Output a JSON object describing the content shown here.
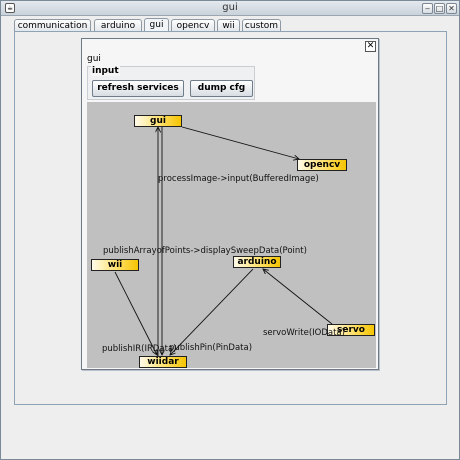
{
  "window": {
    "title": "gui",
    "app_icon": "java-cup-icon",
    "controls": [
      "minimize-icon",
      "maximize-icon",
      "close-icon"
    ]
  },
  "tabs": [
    {
      "label": "communication",
      "selected": false
    },
    {
      "label": "arduino",
      "selected": false
    },
    {
      "label": "gui",
      "selected": true
    },
    {
      "label": "opencv",
      "selected": false
    },
    {
      "label": "wii",
      "selected": false
    },
    {
      "label": "custom",
      "selected": false
    }
  ],
  "panel": {
    "title": "gui",
    "close_symbol": "✕",
    "input_group": {
      "label": "input",
      "buttons": [
        "refresh services",
        "dump cfg"
      ]
    }
  },
  "graph": {
    "background": "#c0c0c0",
    "node_color": "#ffd800",
    "nodes": [
      "gui",
      "opencv",
      "wii",
      "arduino",
      "servo",
      "wiidar"
    ],
    "edges": [
      {
        "from": "gui",
        "to": "opencv",
        "label": "processImage->input(BufferedImage)"
      },
      {
        "from": "wiidar",
        "to": "gui",
        "label": "publishArrayofPoints->displaySweepData(Point)"
      },
      {
        "from": "wii",
        "to": "wiidar",
        "label": "publishIR(IRData)"
      },
      {
        "from": "arduino",
        "to": "wiidar",
        "label": "publishPin(PinData)"
      },
      {
        "from": "servo",
        "to": "arduino",
        "label": "servoWrite(IOData)"
      }
    ]
  }
}
